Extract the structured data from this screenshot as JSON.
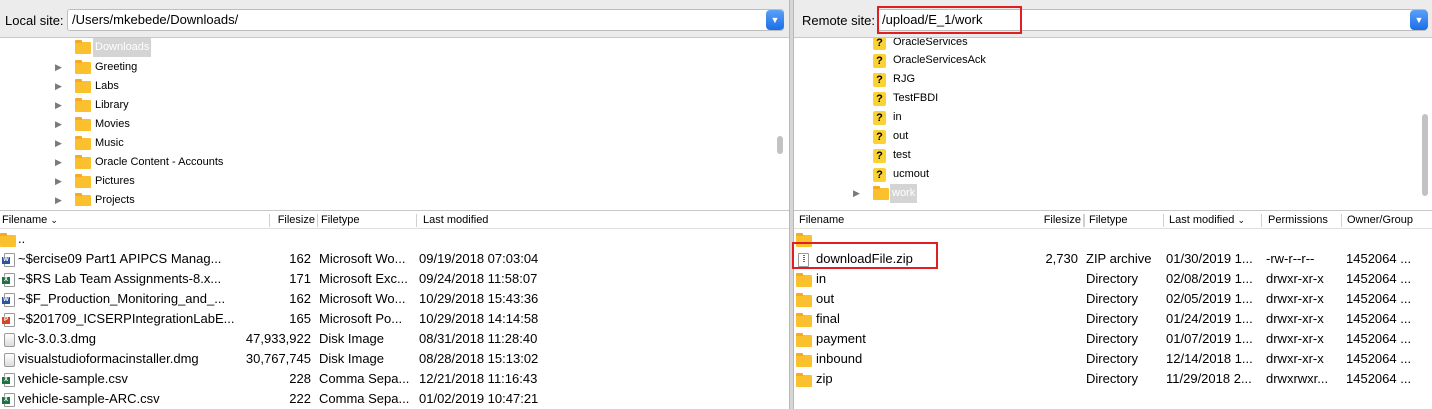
{
  "local": {
    "label": "Local site:",
    "path": "/Users/mkebede/Downloads/",
    "tree": [
      {
        "name": "Downloads",
        "expandable": false,
        "selected": true
      },
      {
        "name": "Greeting",
        "expandable": true,
        "selected": false
      },
      {
        "name": "Labs",
        "expandable": true,
        "selected": false
      },
      {
        "name": "Library",
        "expandable": true,
        "selected": false
      },
      {
        "name": "Movies",
        "expandable": true,
        "selected": false
      },
      {
        "name": "Music",
        "expandable": true,
        "selected": false
      },
      {
        "name": "Oracle Content - Accounts",
        "expandable": true,
        "selected": false
      },
      {
        "name": "Pictures",
        "expandable": true,
        "selected": false
      },
      {
        "name": "Projects",
        "expandable": true,
        "selected": false
      }
    ],
    "columns": {
      "filename": "Filename",
      "filesize": "Filesize",
      "filetype": "Filetype",
      "modified": "Last modified"
    },
    "files": [
      {
        "name": "..",
        "size": "",
        "type": "",
        "modified": "",
        "icon": "folder-icon"
      },
      {
        "name": "~$ercise09 Part1 APIPCS Manag...",
        "size": "162",
        "type": "Microsoft Wo...",
        "modified": "09/19/2018 07:03:04",
        "icon": "word-doc-icon"
      },
      {
        "name": "~$RS Lab Team Assignments-8.x...",
        "size": "171",
        "type": "Microsoft Exc...",
        "modified": "09/24/2018 11:58:07",
        "icon": "excel-doc-icon"
      },
      {
        "name": "~$F_Production_Monitoring_and_...",
        "size": "162",
        "type": "Microsoft Wo...",
        "modified": "10/29/2018 15:43:36",
        "icon": "word-doc-icon"
      },
      {
        "name": "~$201709_ICSERPIntegrationLabE...",
        "size": "165",
        "type": "Microsoft Po...",
        "modified": "10/29/2018 14:14:58",
        "icon": "powerpoint-doc-icon"
      },
      {
        "name": "vlc-3.0.3.dmg",
        "size": "47,933,922",
        "type": "Disk Image",
        "modified": "08/31/2018 11:28:40",
        "icon": "disk-image-icon"
      },
      {
        "name": "visualstudioformacinstaller.dmg",
        "size": "30,767,745",
        "type": "Disk Image",
        "modified": "08/28/2018 15:13:02",
        "icon": "disk-image-icon"
      },
      {
        "name": "vehicle-sample.csv",
        "size": "228",
        "type": "Comma Sepa...",
        "modified": "12/21/2018 11:16:43",
        "icon": "csv-doc-icon"
      },
      {
        "name": "vehicle-sample-ARC.csv",
        "size": "222",
        "type": "Comma Sepa...",
        "modified": "01/02/2019 10:47:21",
        "icon": "csv-doc-icon"
      }
    ]
  },
  "remote": {
    "label": "Remote site:",
    "path": "/upload/E_1/work",
    "tree": [
      {
        "name": "OracleServices",
        "kind": "unknown"
      },
      {
        "name": "OracleServicesAck",
        "kind": "unknown"
      },
      {
        "name": "RJG",
        "kind": "unknown"
      },
      {
        "name": "TestFBDI",
        "kind": "unknown"
      },
      {
        "name": "in",
        "kind": "unknown"
      },
      {
        "name": "out",
        "kind": "unknown"
      },
      {
        "name": "test",
        "kind": "unknown"
      },
      {
        "name": "ucmout",
        "kind": "unknown"
      },
      {
        "name": "work",
        "kind": "folder",
        "selected": true
      }
    ],
    "columns": {
      "filename": "Filename",
      "filesize": "Filesize",
      "filetype": "Filetype",
      "modified": "Last modified",
      "permissions": "Permissions",
      "owner": "Owner/Group"
    },
    "files": [
      {
        "name": "",
        "size": "",
        "type": "",
        "modified": "",
        "perms": "",
        "owner": "",
        "icon": "folder-icon"
      },
      {
        "name": "downloadFile.zip",
        "size": "2,730",
        "type": "ZIP archive",
        "modified": "01/30/2019 1...",
        "perms": "-rw-r--r--",
        "owner": "1452064 ...",
        "icon": "zip-file-icon"
      },
      {
        "name": "in",
        "size": "",
        "type": "Directory",
        "modified": "02/08/2019 1...",
        "perms": "drwxr-xr-x",
        "owner": "1452064 ...",
        "icon": "folder-icon"
      },
      {
        "name": "out",
        "size": "",
        "type": "Directory",
        "modified": "02/05/2019 1...",
        "perms": "drwxr-xr-x",
        "owner": "1452064 ...",
        "icon": "folder-icon"
      },
      {
        "name": "final",
        "size": "",
        "type": "Directory",
        "modified": "01/24/2019 1...",
        "perms": "drwxr-xr-x",
        "owner": "1452064 ...",
        "icon": "folder-icon"
      },
      {
        "name": "payment",
        "size": "",
        "type": "Directory",
        "modified": "01/07/2019 1...",
        "perms": "drwxr-xr-x",
        "owner": "1452064 ...",
        "icon": "folder-icon"
      },
      {
        "name": "inbound",
        "size": "",
        "type": "Directory",
        "modified": "12/14/2018 1...",
        "perms": "drwxr-xr-x",
        "owner": "1452064 ...",
        "icon": "folder-icon"
      },
      {
        "name": "zip",
        "size": "",
        "type": "Directory",
        "modified": "11/29/2018 2...",
        "perms": "drwxrwxr...",
        "owner": "1452064 ...",
        "icon": "folder-icon"
      }
    ]
  },
  "colors": {
    "highlight": "#e02020",
    "folder": "#fbc02d",
    "accent": "#1b6ee8"
  }
}
